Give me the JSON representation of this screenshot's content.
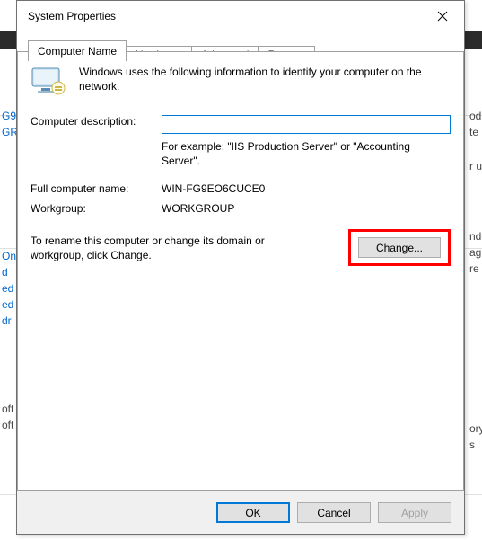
{
  "dialog": {
    "title": "System Properties",
    "tabs": [
      {
        "label": "Computer Name",
        "active": true
      },
      {
        "label": "Hardware",
        "active": false
      },
      {
        "label": "Advanced",
        "active": false
      },
      {
        "label": "Remote",
        "active": false
      }
    ],
    "intro": "Windows uses the following information to identify your computer on the network.",
    "fields": {
      "description_label": "Computer description:",
      "description_value": "",
      "description_example": "For example: \"IIS Production Server\" or \"Accounting Server\".",
      "fullname_label": "Full computer name:",
      "fullname_value": "WIN-FG9EO6CUCE0",
      "workgroup_label": "Workgroup:",
      "workgroup_value": "WORKGROUP"
    },
    "change_section": {
      "text": "To rename this computer or change its domain or workgroup, click Change.",
      "button": "Change..."
    },
    "buttons": {
      "ok": "OK",
      "cancel": "Cancel",
      "apply": "Apply"
    }
  },
  "background": {
    "left_fragments": [
      "G9",
      "GR",
      "On",
      "d",
      "ed",
      "ed",
      "dr",
      "oft",
      "oft"
    ],
    "right_fragments": [
      "od",
      "te",
      "r u",
      "ndo",
      "ag",
      "re",
      "ory",
      "s"
    ]
  }
}
